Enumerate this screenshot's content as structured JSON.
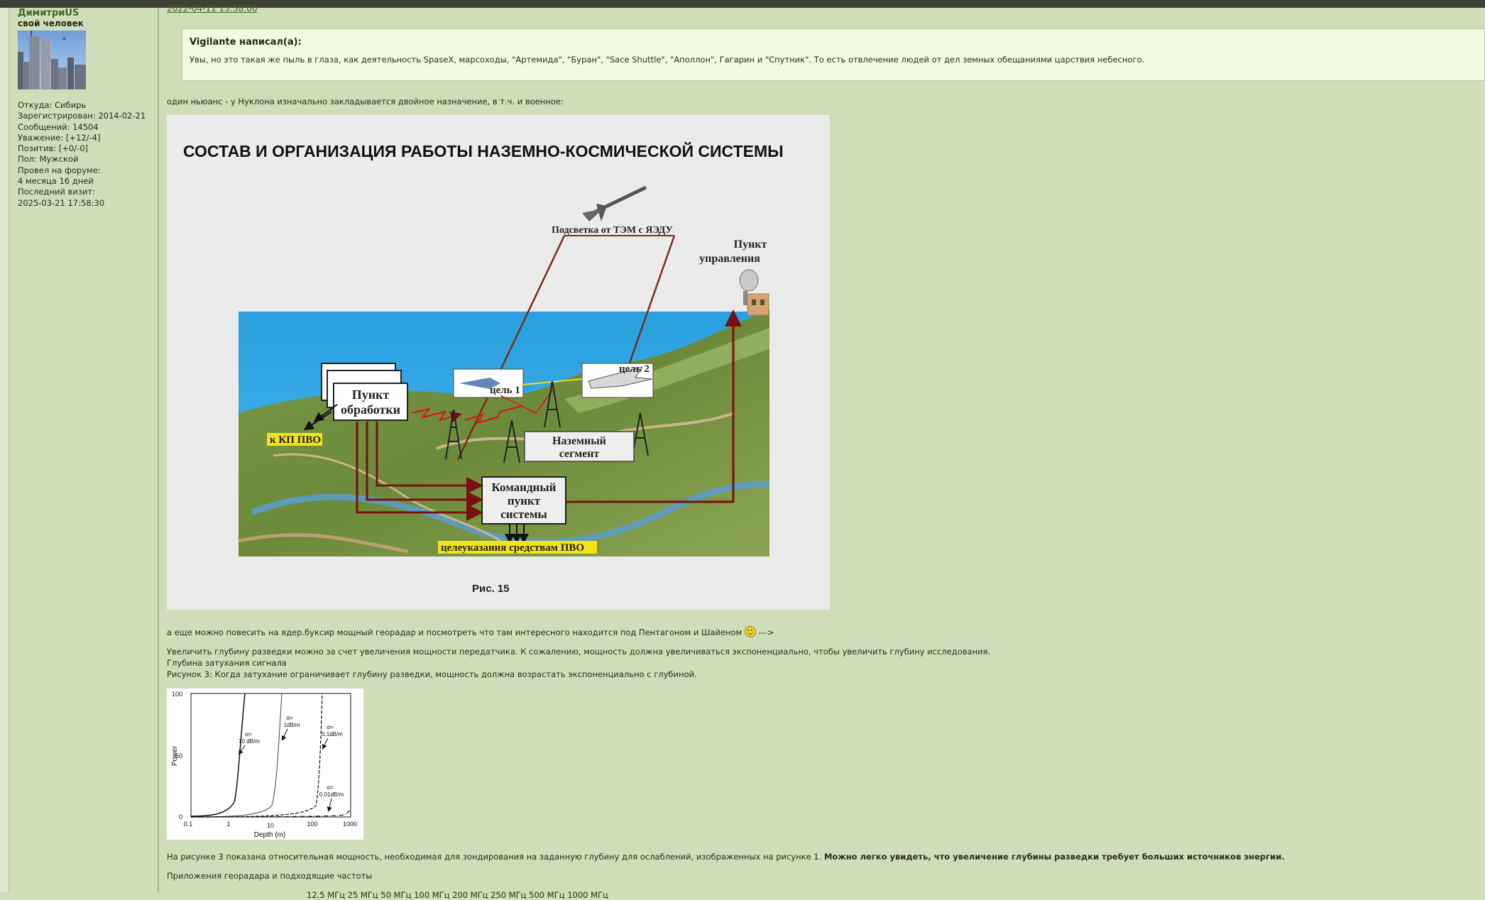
{
  "user": {
    "name": "ДимитриUS",
    "title": "свой человек",
    "from": "Откуда: Сибирь",
    "registered": "Зарегистрирован: 2014-02-21",
    "messages": "Сообщений: 14504",
    "respect": "Уважение: [+12/-4]",
    "positive": "Позитив: [+0/-0]",
    "gender": "Пол: Мужской",
    "forum_time_label": "Провел на форуме:",
    "forum_time": "4 месяца 16 дней",
    "last_visit_label": "Последний визит:",
    "last_visit": "2025-03-21 17:58:30"
  },
  "post": {
    "date": "2022-04-11 13:58:00",
    "quote_author": "Vigilante написал(а):",
    "quote_text": "Увы, но это такая же пыль в глаза, как деятельность SpaseX, марсоходы, \"Артемида\", \"Буран\", \"Sace Shuttle\", \"Аполлон\", Гагарин и \"Спутник\". То есть отвлечение людей от дел земных обещаниями царствия небесного.",
    "p1": "один ньюанс -  у Нуклона изначально закладывается двойное назначение,  в т.ч. и военное:",
    "p2_before": "а еще можно повесить на ядер.буксир мощный георадар и посмотреть что там интересного находится под Пентагоном и Шайеном",
    "p2_after": "--->",
    "p3": "Увеличить глубину разведки можно за счет увеличения мощности передатчика. К сожалению, мощность должна увеличиваться экспоненциально, чтобы увеличить глубину исследования.",
    "p4": "Глубина затухания сигнала",
    "p5": "Рисунок 3: Когда затухание ограничивает глубину разведки, мощность должна возрастать экспоненциально с глубиной.",
    "p6_normal": "На рисунке 3 показана относительная мощность, необходимая для зондирования на заданную глубину для ослаблений, изображенных на рисунке 1.",
    "p6_bold": "Можно легко увидеть, что увеличение глубины разведки требует больших источников энергии.",
    "p7": "Приложения георадара и подходящие частоты",
    "p8": "12.5 МГц 25 МГц 50 МГц 100 МГц 200 МГц 250 МГц 500 МГц 1000 МГц"
  },
  "figure1": {
    "title": "СОСТАВ И ОРГАНИЗАЦИЯ РАБОТЫ НАЗЕМНО-КОСМИЧЕСКОЙ СИСТЕМЫ",
    "illumination": "Подсветка от ТЭМ с ЯЭДУ",
    "control_point_1": "Пункт",
    "control_point_2": "управления",
    "processing_1": "Пункт",
    "processing_2": "обработки",
    "target1": "цель 1",
    "target2": "цель 2",
    "kp_pvo": "к КП ПВО",
    "ground_1": "Наземный",
    "ground_2": "сегмент",
    "command_1": "Командный",
    "command_2": "пункт",
    "command_3": "системы",
    "target_designation": "целеуказания средствам ПВО",
    "caption": "Рис. 15"
  },
  "figure2": {
    "ylabel": "Power",
    "xlabel": "Depth (m)",
    "y_ticks": [
      "100",
      "50",
      "0"
    ],
    "x_ticks": [
      "0.1",
      "1",
      "10",
      "100",
      "1000"
    ],
    "labels": [
      {
        "a": "α=",
        "b": "10 dB/m"
      },
      {
        "a": "α=",
        "b": "1dB/m"
      },
      {
        "a": "α=",
        "b": "0.1dB/m"
      },
      {
        "a": "α=",
        "b": "0.01dB/m"
      }
    ]
  }
}
